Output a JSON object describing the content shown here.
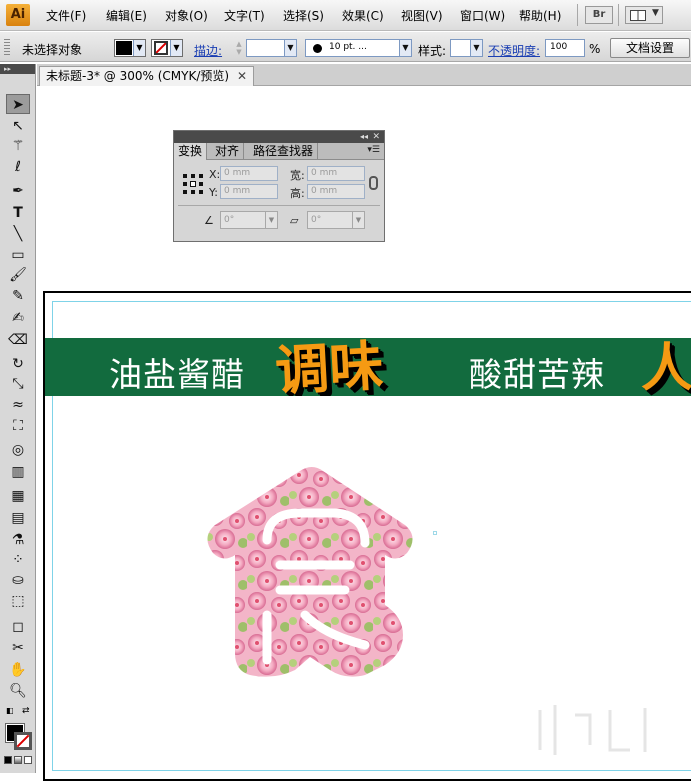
{
  "app": {
    "logo": "Ai"
  },
  "menubar": {
    "items": [
      "文件(F)",
      "编辑(E)",
      "对象(O)",
      "文字(T)",
      "选择(S)",
      "效果(C)",
      "视图(V)",
      "窗口(W)",
      "帮助(H)"
    ],
    "bridge_label": "Br"
  },
  "controlbar": {
    "selection_status": "未选择对象",
    "stroke_label": "描边:",
    "brush_size": "10 pt. ...",
    "style_label": "样式:",
    "opacity_label": "不透明度:",
    "opacity_value": "100",
    "opacity_unit": "%",
    "doc_setup": "文档设置"
  },
  "document": {
    "tab_title": "未标题-3* @ 300% (CMYK/预览)"
  },
  "transform_panel": {
    "tabs": [
      "变换",
      "对齐",
      "路径查找器"
    ],
    "x_label": "X:",
    "x_value": "0 mm",
    "y_label": "Y:",
    "y_value": "0 mm",
    "w_label": "宽:",
    "w_value": "0 mm",
    "h_label": "高:",
    "h_value": "0 mm",
    "rotate_value": "0°",
    "shear_value": "0°"
  },
  "banner": {
    "text_1": "油盐酱醋",
    "accent_1": "调味",
    "text_2": "酸甜苦辣",
    "accent_2": "人"
  },
  "colors": {
    "banner_green": "#126b3e",
    "accent_orange": "#f59a13",
    "blossom_pink": "#f2a9c0"
  }
}
